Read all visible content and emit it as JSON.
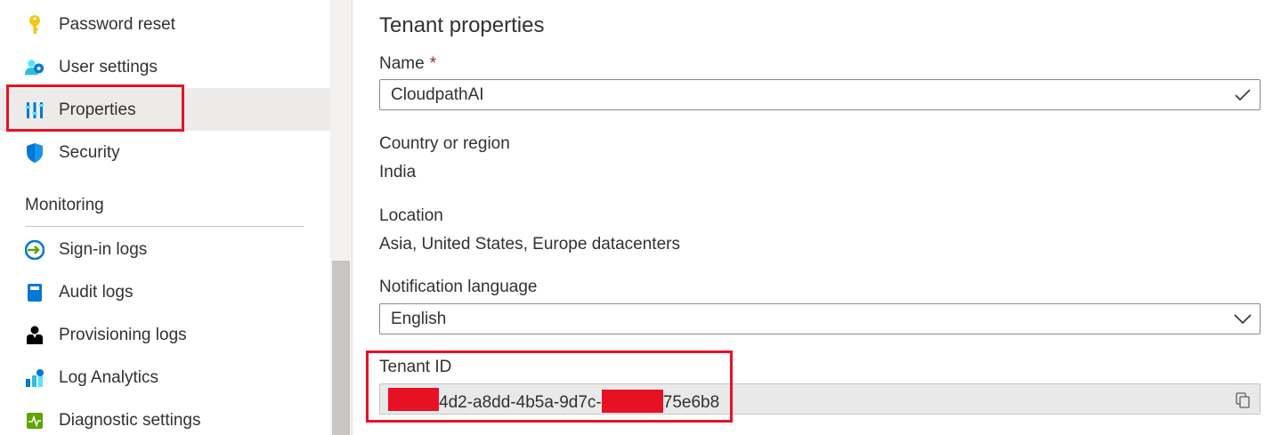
{
  "sidebar": {
    "items": [
      {
        "label": "Password reset",
        "icon": "key-icon"
      },
      {
        "label": "User settings",
        "icon": "user-settings-icon"
      },
      {
        "label": "Properties",
        "icon": "properties-icon",
        "selected": true
      },
      {
        "label": "Security",
        "icon": "shield-icon"
      }
    ],
    "monitoring_header": "Monitoring",
    "monitoring_items": [
      {
        "label": "Sign-in logs",
        "icon": "sign-in-icon"
      },
      {
        "label": "Audit logs",
        "icon": "book-icon"
      },
      {
        "label": "Provisioning logs",
        "icon": "provisioning-user-icon"
      },
      {
        "label": "Log Analytics",
        "icon": "analytics-icon"
      },
      {
        "label": "Diagnostic settings",
        "icon": "diagnostic-icon"
      }
    ]
  },
  "main": {
    "title": "Tenant properties",
    "name_label": "Name",
    "required_mark": "*",
    "name_value": "CloudpathAI",
    "country_label": "Country or region",
    "country_value": "India",
    "location_label": "Location",
    "location_value": "Asia, United States, Europe datacenters",
    "notification_label": "Notification language",
    "notification_value": "English",
    "tenant_id_label": "Tenant ID",
    "tenant_id_value": "4d2-a8dd-4b5a-9d7c-",
    "tenant_id_suffix": "75e6b8"
  },
  "colors": {
    "highlight": "#e81123",
    "accent": "#0078d4",
    "selected_bg": "#edebe9"
  }
}
